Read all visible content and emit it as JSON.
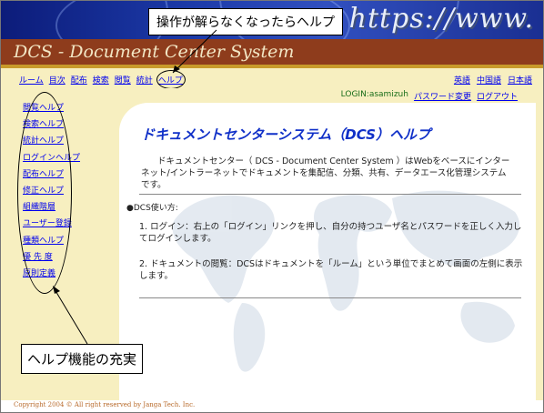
{
  "banner": {
    "url_text": "https://www."
  },
  "callouts": {
    "top": "操作が解らなくなったらヘルプ",
    "bottom": "ヘルプ機能の充実"
  },
  "app_title": "DCS - Document Center System",
  "nav": {
    "left": [
      "ルーム",
      "目次",
      "配布",
      "検索",
      "閲覧",
      "統計",
      "ヘルプ"
    ],
    "right": [
      "英語",
      "中国語",
      "日本語"
    ]
  },
  "login": {
    "user_label": "LOGIN:asamizuh",
    "password_link": "パスワード変更",
    "logout_link": "ログアウト"
  },
  "sidebar": {
    "items": [
      "閲覧ヘルプ",
      "検索ヘルプ",
      "統計ヘルプ",
      "ログインヘルプ",
      "配布ヘルプ",
      "修正ヘルプ",
      "組織階層",
      "ユーザー登録",
      "種類ヘルプ",
      "優 先 度",
      "原則定義"
    ]
  },
  "main": {
    "title": "ドキュメントセンターシステム（DCS）ヘルプ",
    "intro": "ドキュメントセンター（ DCS - Document Center System ）はWebをベースにインターネット/イントラーネットでドキュメントを集配信、分類、共有、データエース化管理システムです。",
    "usage_heading": "●DCS使い方:",
    "step1": "1. ログイン：右上の「ログイン」リンクを押し、自分の持つユーザ名とパスワードを正しく入力してログインします。",
    "step2": "2. ドキュメントの閲覧：DCSはドキュメントを「ルーム」という単位でまとめて画面の左側に表示します。"
  },
  "footer": {
    "copyright": "Copyright 2004 © All right reserved by Janga Tech. Inc."
  },
  "colors": {
    "banner_blue": "#1c3aa8",
    "title_brown": "#8e3c1c",
    "cream": "#f7efc0",
    "link_blue": "#0000ee",
    "heading_blue": "#1030c8"
  }
}
